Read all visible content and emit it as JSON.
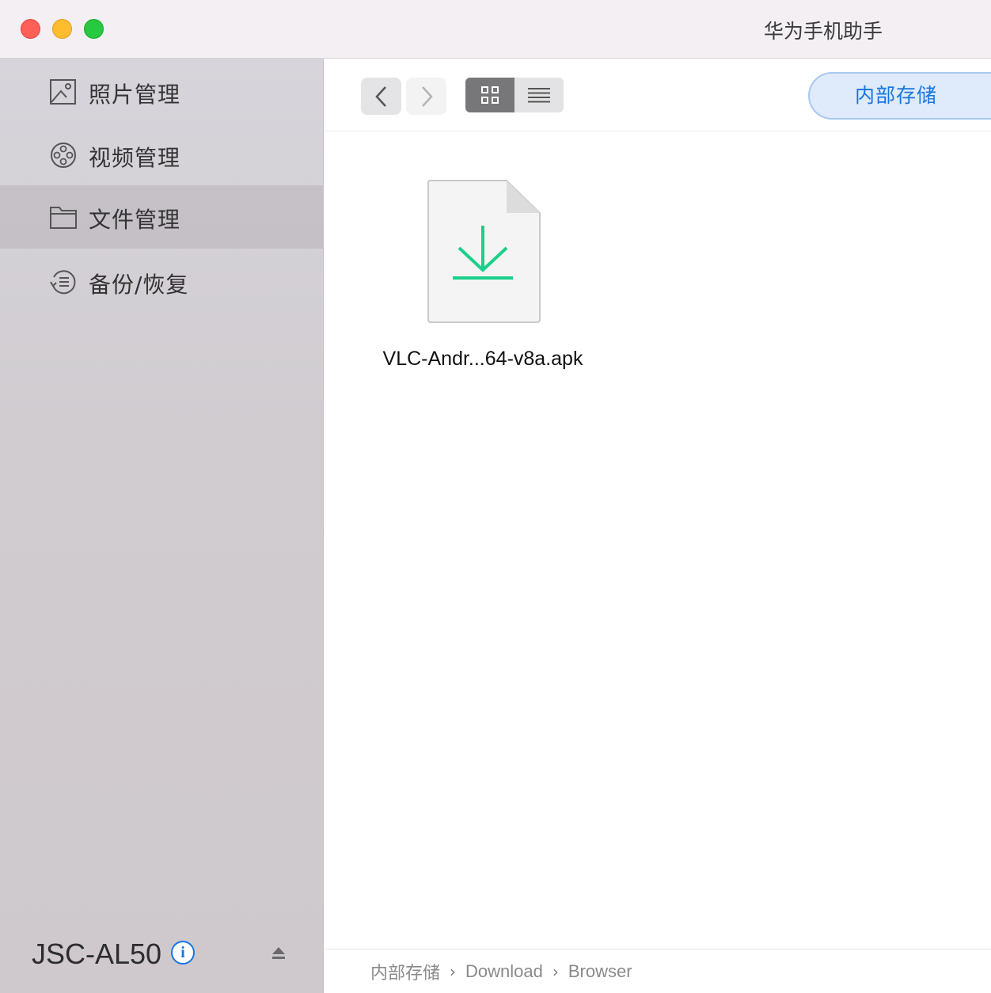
{
  "window": {
    "title": "华为手机助手"
  },
  "sidebar": {
    "items": [
      {
        "label": "照片管理",
        "icon": "photo-icon",
        "active": false
      },
      {
        "label": "视频管理",
        "icon": "video-reel-icon",
        "active": false
      },
      {
        "label": "文件管理",
        "icon": "folder-icon",
        "active": true
      },
      {
        "label": "备份/恢复",
        "icon": "backup-restore-icon",
        "active": false
      }
    ],
    "device": {
      "name": "JSC-AL50",
      "info_glyph": "i"
    }
  },
  "toolbar": {
    "back_icon": "chevron-left-icon",
    "forward_icon": "chevron-right-icon",
    "view_modes": [
      "grid",
      "list"
    ],
    "active_view": "grid",
    "storage_label": "内部存储"
  },
  "files": [
    {
      "name": "VLC-Andr...64-v8a.apk",
      "icon": "download-file-icon",
      "accent": "#1ccf8a"
    }
  ],
  "breadcrumb": {
    "parts": [
      "内部存储",
      "Download",
      "Browser"
    ],
    "separator": "›"
  },
  "colors": {
    "accent_blue": "#1676e0",
    "download_green": "#1ccf8a",
    "sidebar_bg": "#d0ccd0"
  }
}
